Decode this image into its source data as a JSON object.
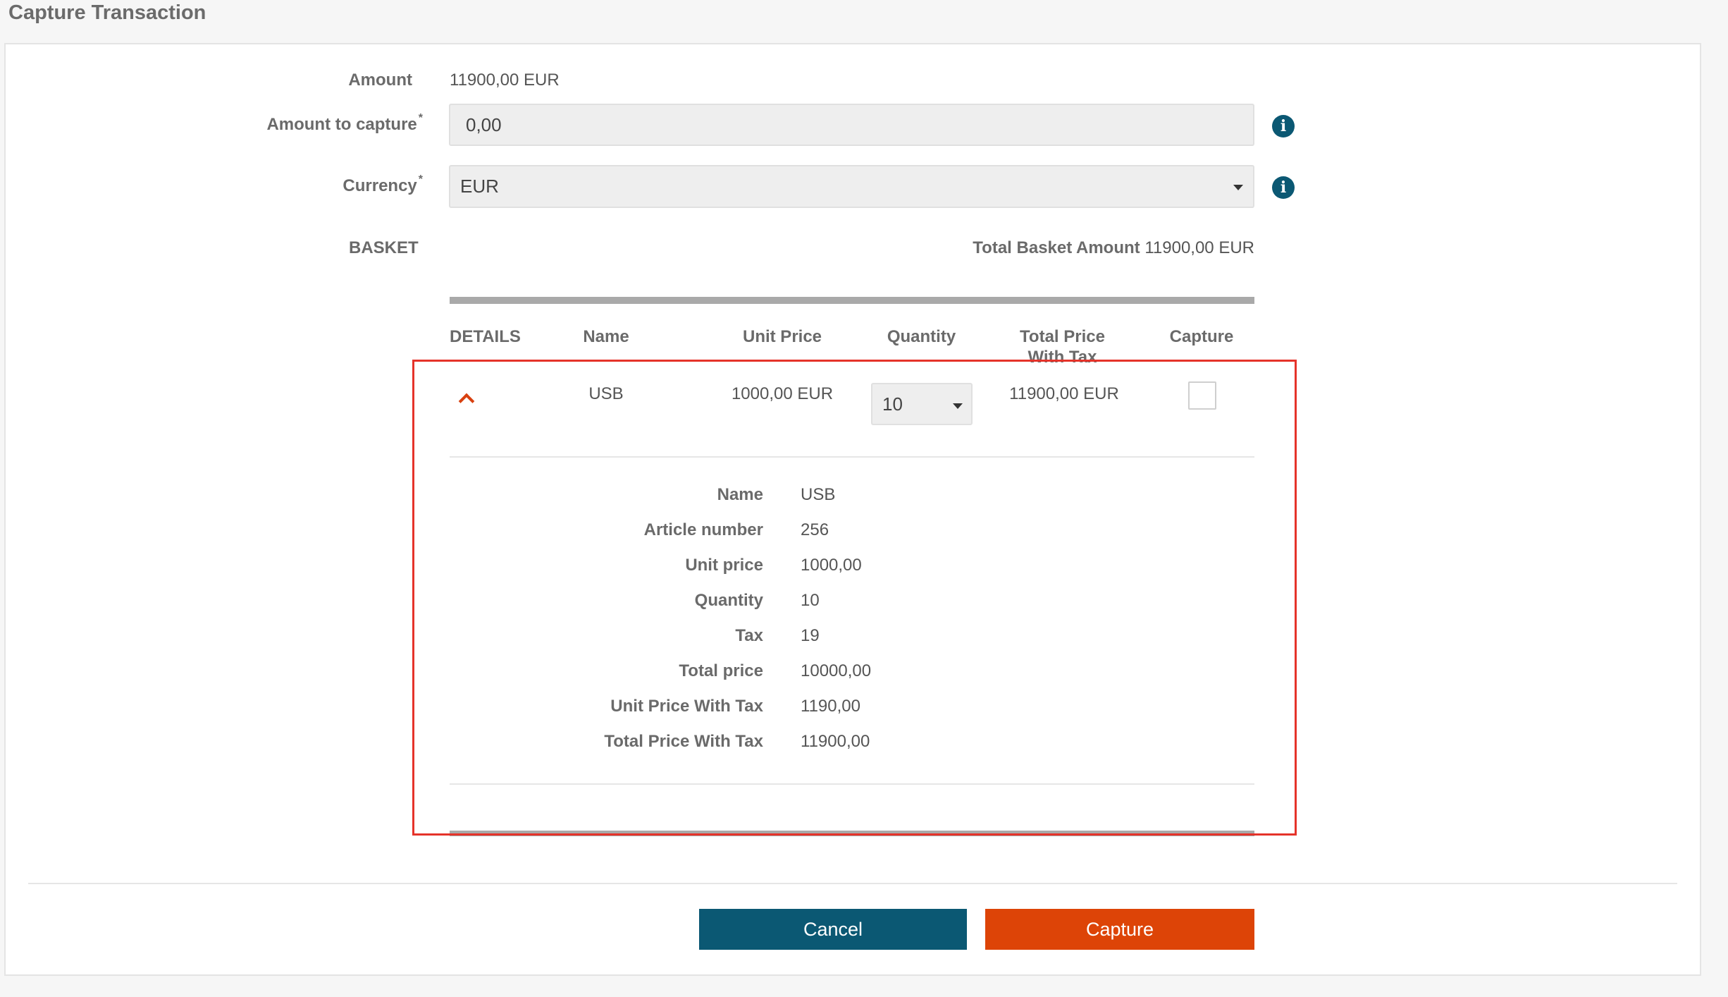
{
  "page": {
    "title": "Capture Transaction"
  },
  "form": {
    "amount_label": "Amount",
    "amount_value": "11900,00 EUR",
    "amount_to_capture_label": "Amount to capture",
    "amount_to_capture_value": "0,00",
    "required_mark": "*",
    "currency_label": "Currency",
    "currency_value": "EUR",
    "info_glyph": "i"
  },
  "basket": {
    "label": "BASKET",
    "total_label": "Total Basket Amount",
    "total_value": "11900,00 EUR",
    "columns": [
      "DETAILS",
      "Name",
      "Unit Price",
      "Quantity",
      "Total Price With Tax",
      "Capture"
    ],
    "row": {
      "name": "USB",
      "unit_price": "1000,00 EUR",
      "quantity": "10",
      "total_price_with_tax": "11900,00 EUR",
      "capture_checked": false
    },
    "details": [
      {
        "label": "Name",
        "value": "USB"
      },
      {
        "label": "Article number",
        "value": "256"
      },
      {
        "label": "Unit price",
        "value": "1000,00"
      },
      {
        "label": "Quantity",
        "value": "10"
      },
      {
        "label": "Tax",
        "value": "19"
      },
      {
        "label": "Total price",
        "value": "10000,00"
      },
      {
        "label": "Unit Price With Tax",
        "value": "1190,00"
      },
      {
        "label": "Total Price With Tax",
        "value": "11900,00"
      }
    ]
  },
  "actions": {
    "cancel_label": "Cancel",
    "capture_label": "Capture"
  },
  "colors": {
    "primary": "#0b5873",
    "accent": "#dd4407",
    "highlight": "#e5332a"
  }
}
